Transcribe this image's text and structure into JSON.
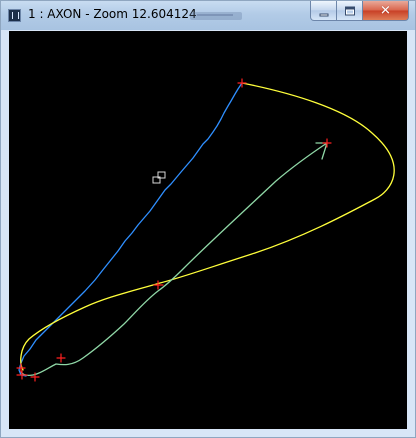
{
  "window": {
    "title": "1 : AXON - Zoom 12.604124",
    "controls": {
      "minimize_icon": "minimize-icon",
      "maximize_icon": "maximize-icon",
      "close_icon": "close-icon",
      "close_glyph": "✕"
    }
  },
  "canvas": {
    "background": "#000000",
    "colors": {
      "axon_blue": "#2f8fff",
      "axon_green": "#8fd7a6",
      "axon_yellow": "#ffff3b",
      "markers": "#ff2020",
      "square_marker": "#d8d8d8"
    },
    "items": [
      {
        "name": "blue-axon-branch",
        "kind": "curve"
      },
      {
        "name": "yellow-loop-branch",
        "kind": "curve"
      },
      {
        "name": "green-right-branch",
        "kind": "curve"
      },
      {
        "name": "red-node-markers",
        "kind": "marker-set"
      },
      {
        "name": "square-node-marker",
        "kind": "marker"
      }
    ]
  }
}
